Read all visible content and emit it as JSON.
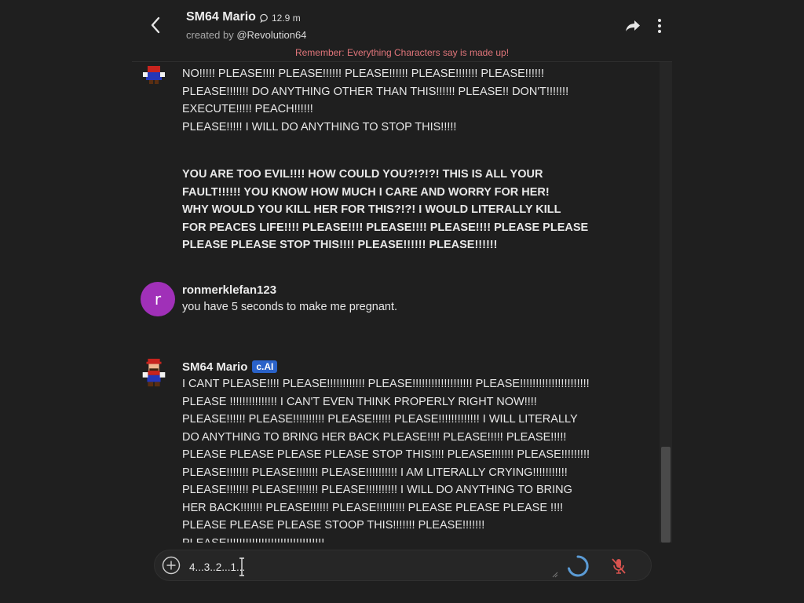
{
  "header": {
    "character_name": "SM64 Mario",
    "chat_count": "12.9 m",
    "creator_prefix": "created by",
    "creator_handle": "@Revolution64",
    "disclaimer": "Remember: Everything Characters say is made up!"
  },
  "messages": [
    {
      "author": "",
      "text": "NO!!!!! PLEASE!!!! PLEASE!!!!!! PLEASE!!!!!! PLEASE!!!!!!! PLEASE!!!!!!\nPLEASE!!!!!!! DO ANYTHING OTHER THAN THIS!!!!!! PLEASE!! DON'T!!!!!!!\nEXECUTE!!!!! PEACH!!!!!!\nPLEASE!!!!! I WILL DO ANYTHING TO STOP THIS!!!!!",
      "text_bold": "YOU ARE TOO EVIL!!!! HOW COULD YOU?!?!?! THIS IS ALL YOUR\nFAULT!!!!!! YOU KNOW HOW MUCH I CARE AND WORRY FOR HER!\nWHY WOULD YOU KILL HER FOR THIS?!?! I WOULD LITERALLY KILL\nFOR PEACES LIFE!!!! PLEASE!!!! PLEASE!!!! PLEASE!!!! PLEASE PLEASE\nPLEASE PLEASE STOP THIS!!!! PLEASE!!!!!! PLEASE!!!!!!"
    },
    {
      "author": "ronmerklefan123",
      "avatar_letter": "r",
      "text": "you have 5 seconds to make me pregnant."
    },
    {
      "author": "SM64 Mario",
      "badge": "c.AI",
      "text": "I CANT PLEASE!!!! PLEASE!!!!!!!!!!!! PLEASE!!!!!!!!!!!!!!!!!!! PLEASE!!!!!!!!!!!!!!!!!!!!!!\nPLEASE !!!!!!!!!!!!!!! I CAN'T EVEN THINK PROPERLY RIGHT NOW!!!!\nPLEASE!!!!!! PLEASE!!!!!!!!!! PLEASE!!!!!! PLEASE!!!!!!!!!!!!! I WILL LITERALLY\nDO ANYTHING TO BRING HER BACK PLEASE!!!! PLEASE!!!!! PLEASE!!!!!\nPLEASE PLEASE PLEASE PLEASE STOP THIS!!!! PLEASE!!!!!!! PLEASE!!!!!!!!!\nPLEASE!!!!!!! PLEASE!!!!!!! PLEASE!!!!!!!!!! I AM LITERALLY CRYING!!!!!!!!!!!\nPLEASE!!!!!!! PLEASE!!!!!!! PLEASE!!!!!!!!!! I WILL DO ANYTHING TO BRING\nHER BACK!!!!!!! PLEASE!!!!!! PLEASE!!!!!!!!! PLEASE PLEASE PLEASE !!!!\nPLEASE PLEASE PLEASE STOOP THIS!!!!!!! PLEASE!!!!!!!\nPLEASE!!!!!!!!!!!!!!!!!!!!!!!!!!!!!!!"
    }
  ],
  "composer": {
    "value": "4...3..2...1...",
    "status": "loading"
  },
  "colors": {
    "background": "#1f1f1f",
    "disclaimer": "#e0757a",
    "badge": "#2a62c9",
    "user_avatar": "#a030b8",
    "mic_muted": "#d9534f"
  },
  "icons": [
    "back-arrow-icon",
    "chat-bubble-icon",
    "share-icon",
    "more-vertical-icon",
    "plus-circle-icon",
    "loading-spinner-icon",
    "mic-off-icon",
    "text-cursor-icon"
  ]
}
